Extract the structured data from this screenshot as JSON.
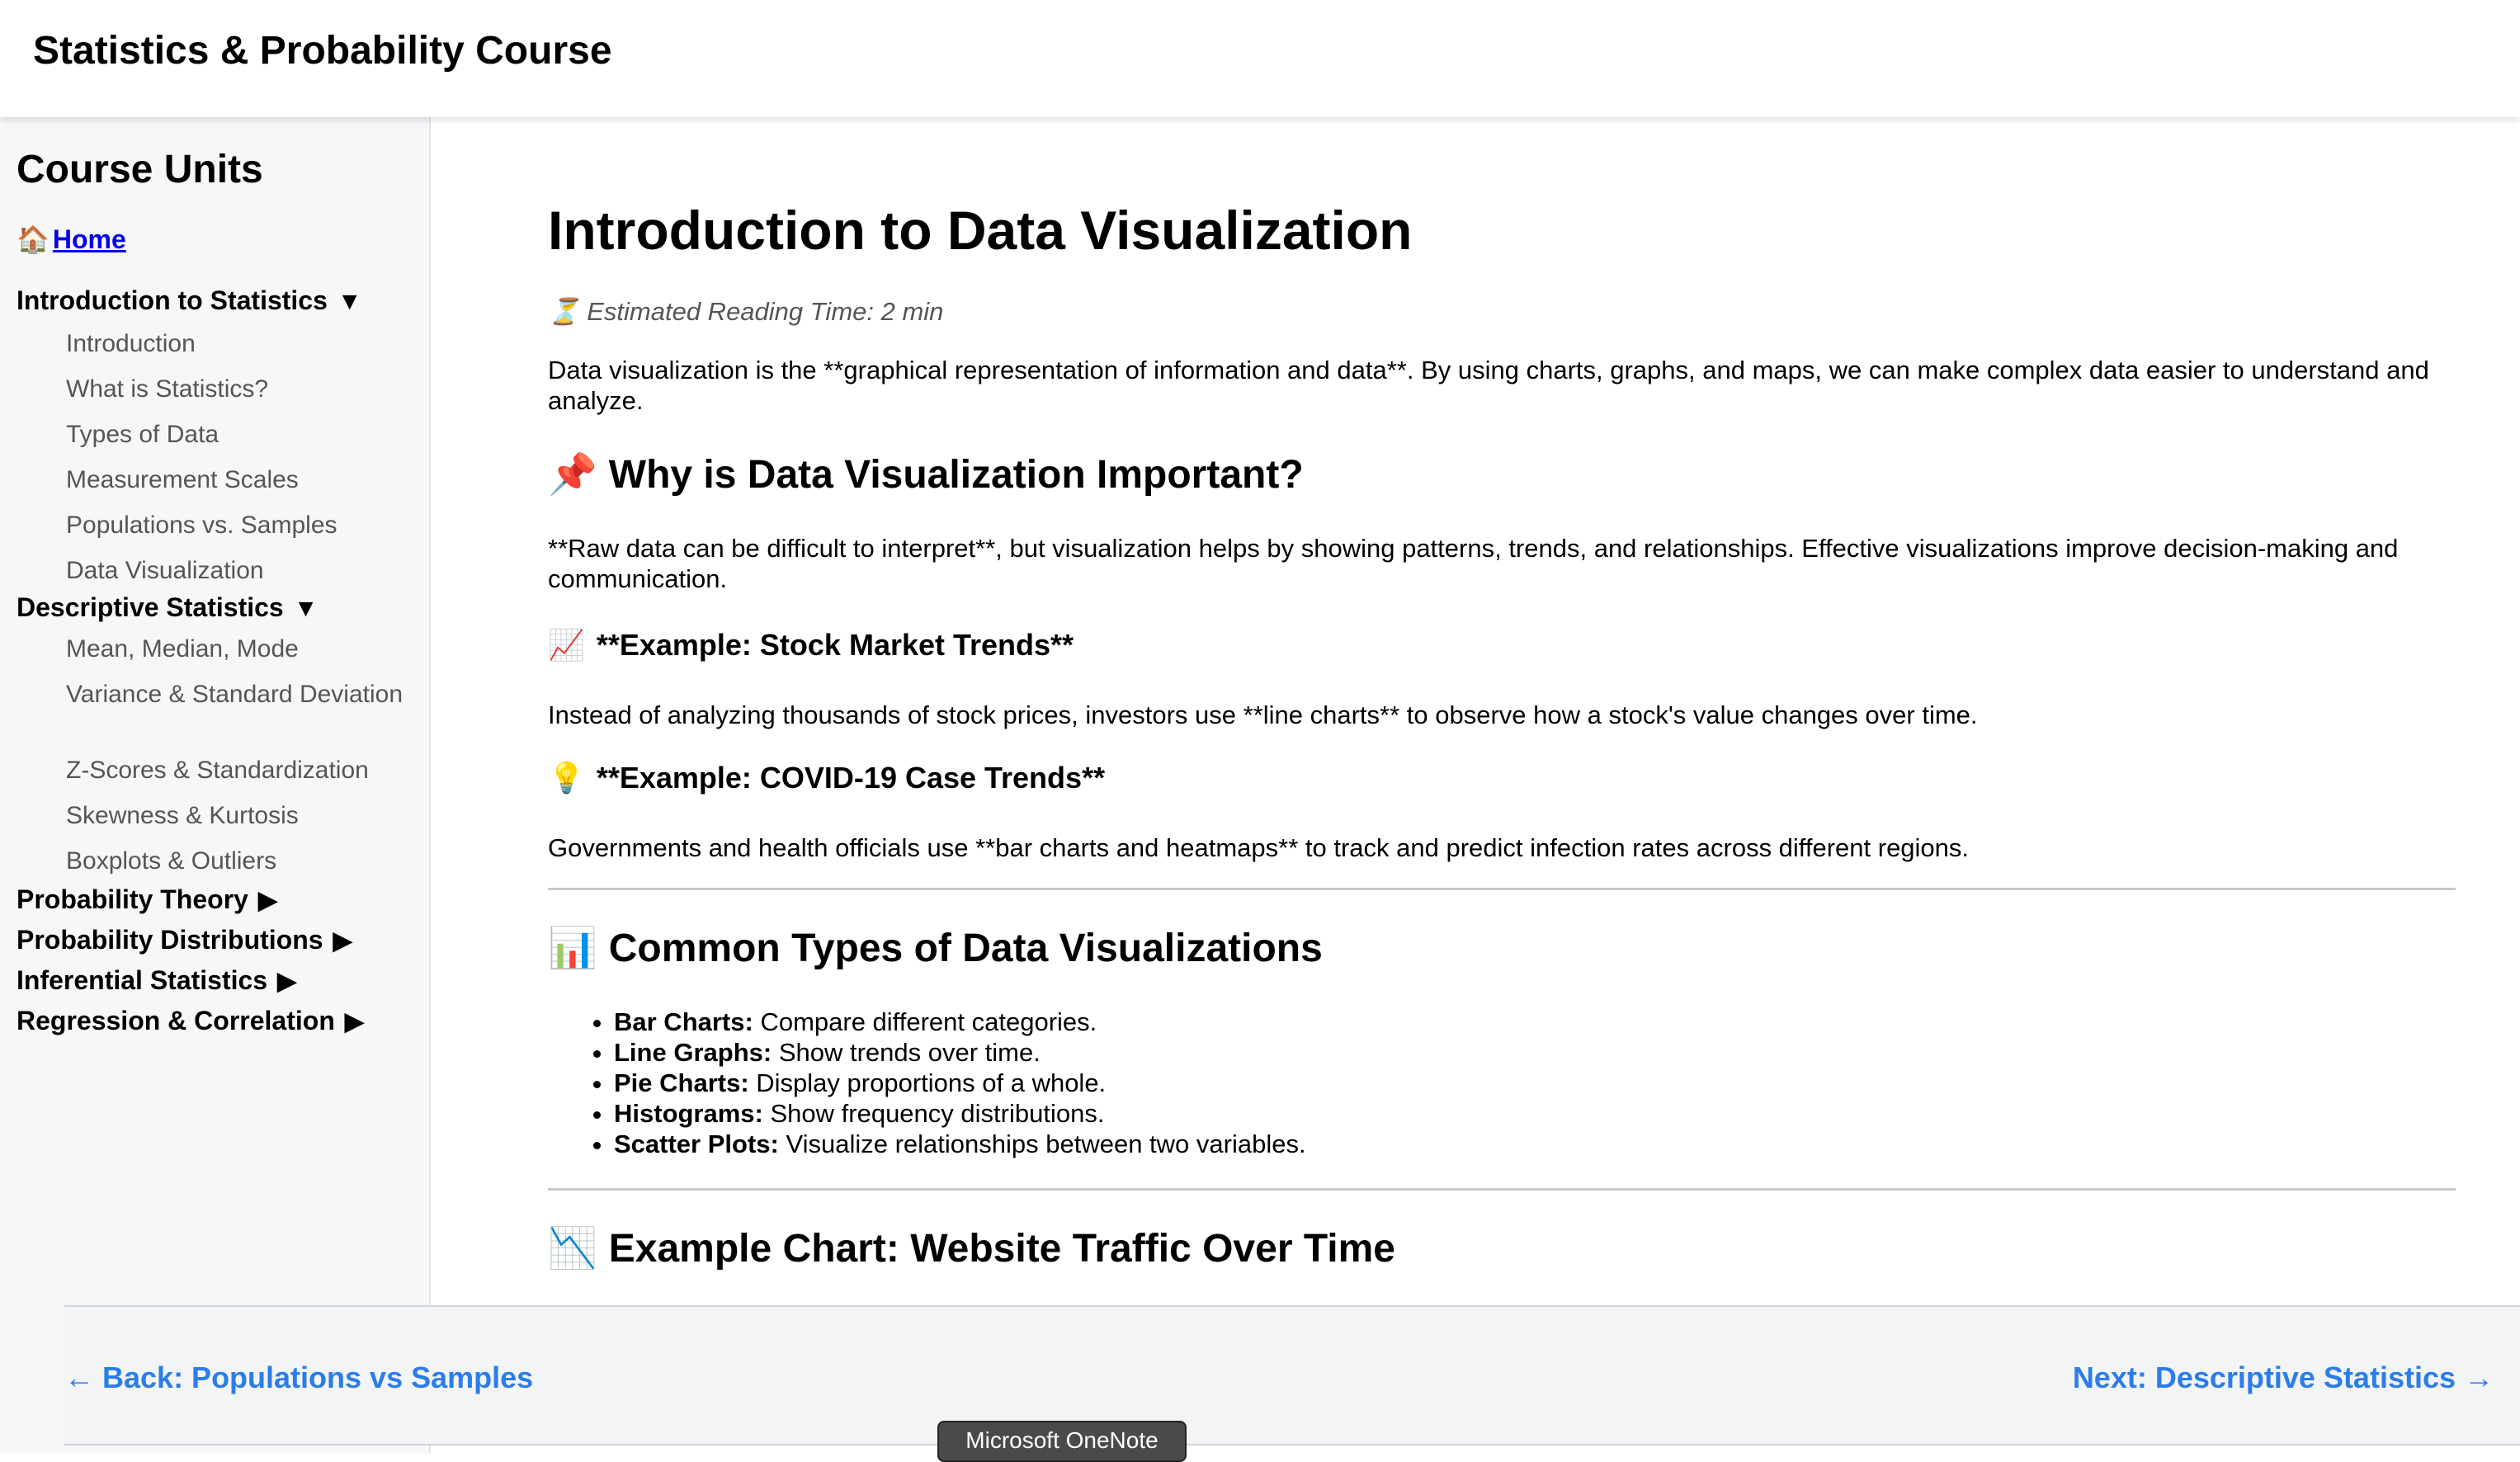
{
  "app": {
    "title": "Statistics & Probability Course"
  },
  "sidebar": {
    "heading": "Course Units",
    "home": {
      "icon": "🏠",
      "label": "Home"
    },
    "units": [
      {
        "label": "Introduction to Statistics",
        "arrow": "▼",
        "expanded": true,
        "lessons": [
          "Introduction",
          "What is Statistics?",
          "Types of Data",
          "Measurement Scales",
          "Populations vs. Samples",
          "Data Visualization"
        ]
      },
      {
        "label": "Descriptive Statistics",
        "arrow": "▼",
        "expanded": true,
        "lessons": [
          "Mean, Median, Mode",
          "Variance & Standard Deviation",
          "Z-Scores & Standardization",
          "Skewness & Kurtosis",
          "Boxplots & Outliers"
        ]
      },
      {
        "label": "Probability Theory",
        "arrow": "▶",
        "expanded": false
      },
      {
        "label": "Probability Distributions",
        "arrow": "▶",
        "expanded": false
      },
      {
        "label": "Inferential Statistics",
        "arrow": "▶",
        "expanded": false
      },
      {
        "label": "Regression & Correlation",
        "arrow": "▶",
        "expanded": false
      }
    ]
  },
  "main": {
    "title": "Introduction to Data Visualization",
    "reading_time": {
      "icon": "⏳",
      "text": "Estimated Reading Time: 2 min"
    },
    "intro": "Data visualization is the **graphical representation of information and data**. By using charts, graphs, and maps, we can make complex data easier to understand and analyze.",
    "why": {
      "icon": "📌",
      "heading": "Why is Data Visualization Important?",
      "text": "**Raw data can be difficult to interpret**, but visualization helps by showing patterns, trends, and relationships. Effective visualizations improve decision-making and communication."
    },
    "example_stock": {
      "icon": "📈",
      "heading": "**Example: Stock Market Trends**",
      "text": "Instead of analyzing thousands of stock prices, investors use **line charts** to observe how a stock's value changes over time."
    },
    "example_covid": {
      "icon": "💡",
      "heading": "**Example: COVID-19 Case Trends**",
      "text": "Governments and health officials use **bar charts and heatmaps** to track and predict infection rates across different regions."
    },
    "types": {
      "icon": "📊",
      "heading": "Common Types of Data Visualizations",
      "items": [
        {
          "term": "Bar Charts:",
          "desc": " Compare different categories."
        },
        {
          "term": "Line Graphs:",
          "desc": " Show trends over time."
        },
        {
          "term": "Pie Charts:",
          "desc": " Display proportions of a whole."
        },
        {
          "term": "Histograms:",
          "desc": " Show frequency distributions."
        },
        {
          "term": "Scatter Plots:",
          "desc": " Visualize relationships between two variables."
        }
      ]
    },
    "example_chart": {
      "icon": "📉",
      "heading": "Example Chart: Website Traffic Over Time"
    }
  },
  "footer": {
    "back": "← Back: Populations vs Samples",
    "next": "Next: Descriptive Statistics →"
  },
  "tooltip": {
    "text": "Microsoft OneNote"
  },
  "colors": {
    "link": "#2b7de9",
    "home_link": "#0000ee",
    "sidebar_bg": "#f6f7f9"
  }
}
